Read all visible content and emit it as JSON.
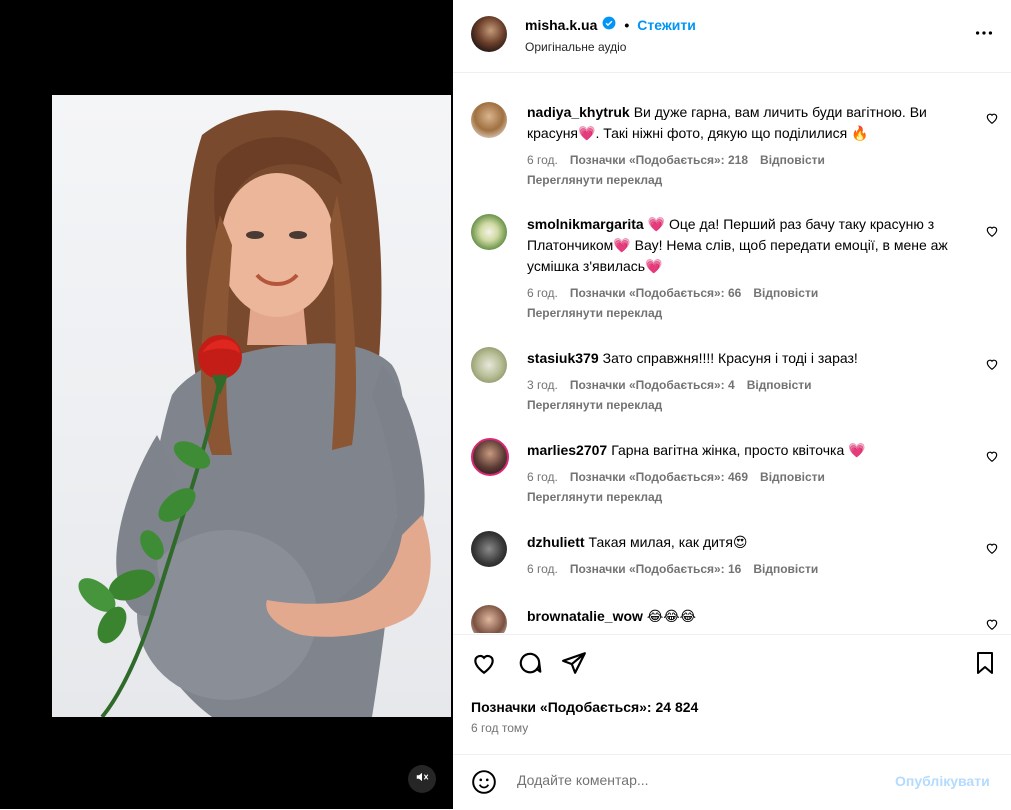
{
  "header": {
    "username": "misha.k.ua",
    "follow_label": "Стежити",
    "audio_label": "Оригінальне аудіо"
  },
  "comments": [
    {
      "user": "nadiya_khytruk",
      "text": "Ви дуже гарна, вам личить буди вагітною. Ви красуня💗. Такі ніжні фото, дякую що поділилися 🔥",
      "time": "6 год.",
      "likes": "Позначки «Подобається»: 218",
      "reply": "Відповісти",
      "translate": "Переглянути переклад"
    },
    {
      "user": "smolnikmargarita",
      "text": "💗 Оце да! Перший раз бачу таку красуню з Платончиком💗 Вау! Нема слів, щоб передати емоції, в мене аж усмішка з'явилась💗",
      "time": "6 год.",
      "likes": "Позначки «Подобається»: 66",
      "reply": "Відповісти",
      "translate": "Переглянути переклад"
    },
    {
      "user": "stasiuk379",
      "text": "Зато справжня!!!! Красуня і тоді і зараз!",
      "time": "3 год.",
      "likes": "Позначки «Подобається»: 4",
      "reply": "Відповісти",
      "translate": "Переглянути переклад"
    },
    {
      "user": "marlies2707",
      "text": "Гарна вагітна жінка, просто квіточка 💗",
      "time": "6 год.",
      "likes": "Позначки «Подобається»: 469",
      "reply": "Відповісти",
      "translate": "Переглянути переклад"
    },
    {
      "user": "dzhuliett",
      "text": "Такая милая, как дитя😍",
      "time": "6 год.",
      "likes": "Позначки «Подобається»: 16",
      "reply": "Відповісти"
    },
    {
      "user": "brownatalie_wow",
      "text": "😂😂😂"
    }
  ],
  "actions": {
    "likes_label": "Позначки «Подобається»: 24 824",
    "time_ago": "6 год тому"
  },
  "add_comment": {
    "placeholder": "Додайте коментар...",
    "post_label": "Опублікувати"
  },
  "icons": {
    "mute": "speaker-muted-icon",
    "like": "heart-icon",
    "comment": "comment-icon",
    "share": "send-icon",
    "save": "bookmark-icon",
    "more": "more-dots-icon",
    "emoji": "smiley-icon",
    "verified": "verified-badge-icon"
  },
  "colors": {
    "accent": "#0095f6",
    "verified": "#0095f6",
    "muted": "#737373",
    "post_disabled": "#b3dbff"
  }
}
